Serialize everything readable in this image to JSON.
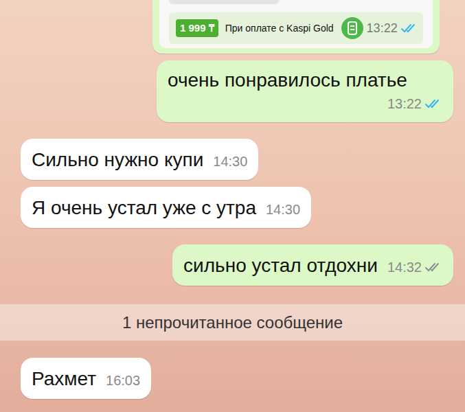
{
  "messages": [
    {
      "kind": "product",
      "direction": "out",
      "price": "1 999 ₸",
      "caption": "При оплате с Kaspi Gold",
      "time": "13:22",
      "read": true
    },
    {
      "kind": "text",
      "direction": "out",
      "text": "очень понравилось платье",
      "time": "13:22",
      "read": true
    },
    {
      "kind": "text",
      "direction": "in",
      "text": "Сильно нужно купи",
      "time": "14:30"
    },
    {
      "kind": "text",
      "direction": "in",
      "text": "Я очень устал уже с утра",
      "time": "14:30"
    },
    {
      "kind": "text",
      "direction": "out",
      "text": "сильно устал отдохни",
      "time": "14:32",
      "read": false
    },
    {
      "kind": "divider",
      "text": "1 непрочитанное сообщение"
    },
    {
      "kind": "text",
      "direction": "in",
      "text": "Рахмет",
      "time": "16:03"
    }
  ]
}
